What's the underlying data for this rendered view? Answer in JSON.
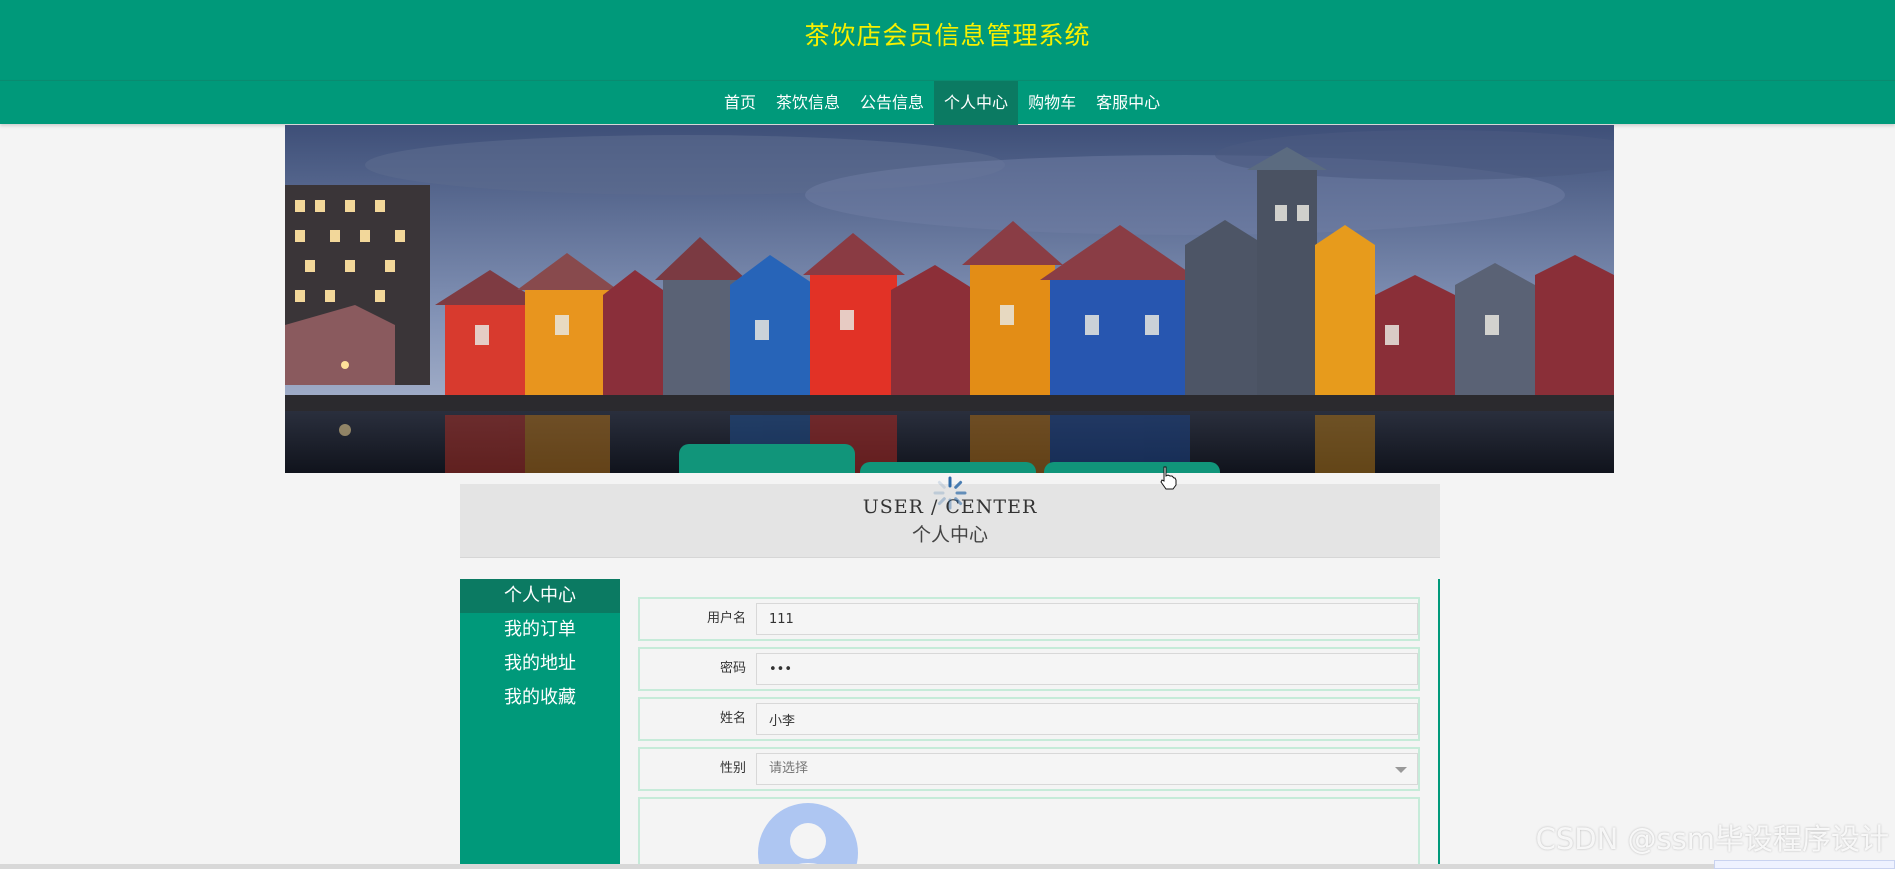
{
  "header": {
    "title": "茶饮店会员信息管理系统"
  },
  "nav": {
    "items": [
      {
        "label": "首页"
      },
      {
        "label": "茶饮信息"
      },
      {
        "label": "公告信息"
      },
      {
        "label": "个人中心"
      },
      {
        "label": "购物车"
      },
      {
        "label": "客服中心"
      }
    ],
    "active": "个人中心"
  },
  "section": {
    "title_en": "USER / CENTER",
    "title_cn": "个人中心"
  },
  "sidebar": {
    "items": [
      {
        "label": "个人中心"
      },
      {
        "label": "我的订单"
      },
      {
        "label": "我的地址"
      },
      {
        "label": "我的收藏"
      }
    ],
    "active": "个人中心"
  },
  "form": {
    "username": {
      "label": "用户名",
      "value": "111"
    },
    "password": {
      "label": "密码",
      "value": "•••"
    },
    "name": {
      "label": "姓名",
      "value": "小李"
    },
    "gender": {
      "label": "性别",
      "placeholder": "请选择"
    }
  },
  "watermark": "CSDN @ssm毕设程序设计",
  "colors": {
    "primary": "#00997a",
    "active": "#0b7a62",
    "title": "#f8f000"
  }
}
